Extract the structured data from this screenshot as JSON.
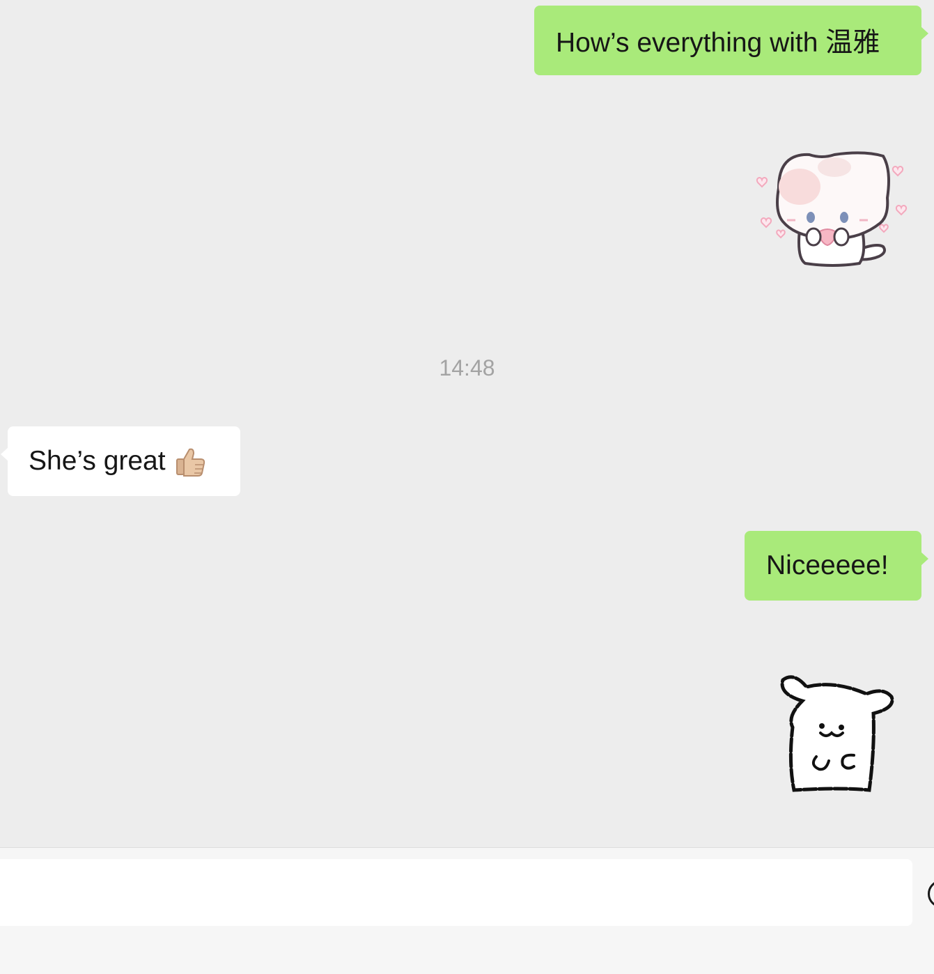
{
  "messages": [
    {
      "direction": "outgoing",
      "text": "How’s everything with 温雅"
    },
    {
      "direction": "incoming",
      "text": "She’s great",
      "emoji": "thumbs-up-icon"
    },
    {
      "direction": "outgoing",
      "text": "Niceeeee!"
    }
  ],
  "stickers": [
    "cat-sticker-icon",
    "dog-sticker-icon"
  ],
  "timestamp": "14:48",
  "input": {
    "value": "",
    "placeholder": ""
  },
  "colors": {
    "background": "#ededed",
    "outgoing_bubble": "#a9ea7a",
    "incoming_bubble": "#ffffff",
    "timestamp_text": "#a3a3a3",
    "input_bar": "#f6f6f6"
  }
}
